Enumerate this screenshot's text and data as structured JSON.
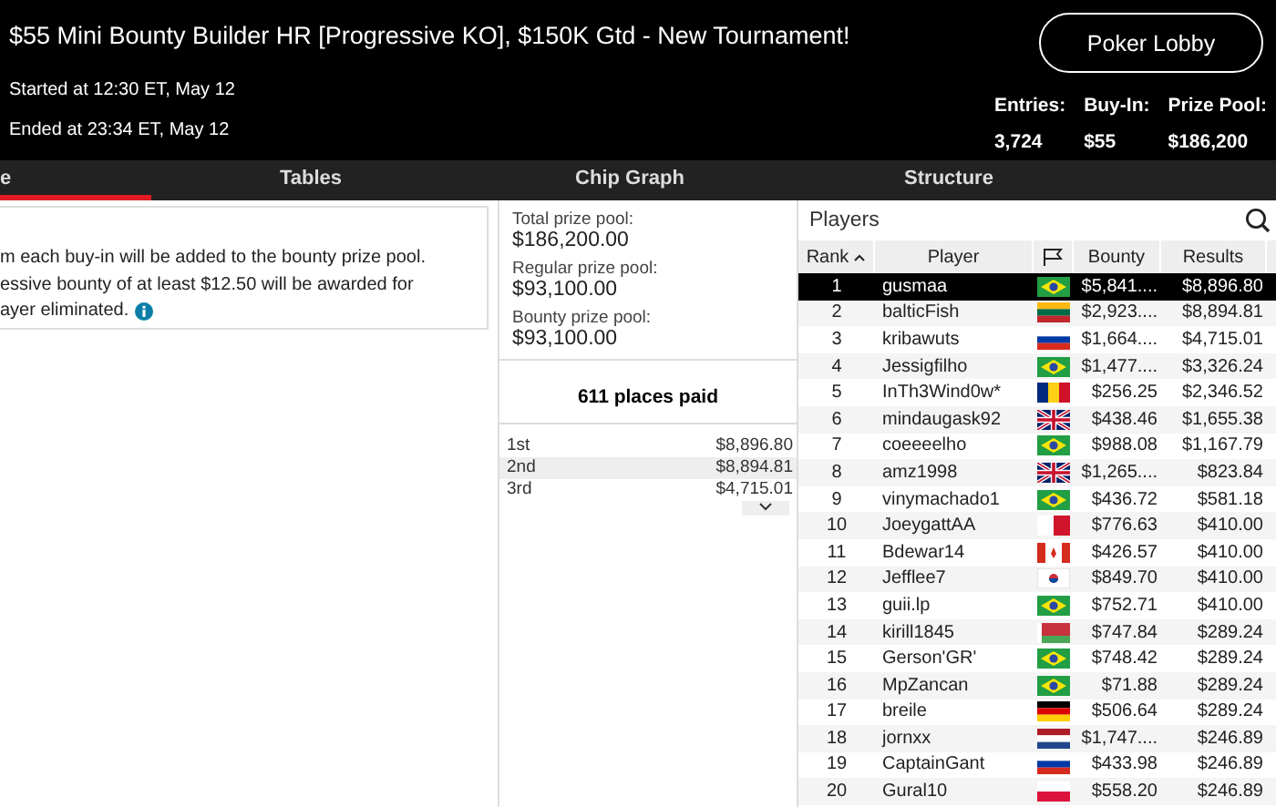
{
  "header": {
    "title": "$55 Mini Bounty Builder HR [Progressive KO], $150K Gtd - New Tournament!",
    "lobby_button": "Poker Lobby",
    "started": "Started at 12:30 ET, May 12",
    "ended": "Ended at 23:34 ET, May 12",
    "stats": [
      {
        "label": "Entries:",
        "value": "3,724"
      },
      {
        "label": "Buy-In:",
        "value": "$55"
      },
      {
        "label": "Prize Pool:",
        "value": "$186,200"
      }
    ]
  },
  "tabs": [
    {
      "label": "e",
      "selected": true
    },
    {
      "label": "Tables",
      "selected": false
    },
    {
      "label": "Chip Graph",
      "selected": false
    },
    {
      "label": "Structure",
      "selected": false
    }
  ],
  "info": {
    "lines": [
      "m each buy-in will be added to the bounty prize pool.",
      "essive bounty of at least $12.50 will be awarded for",
      "ayer eliminated."
    ]
  },
  "prize_pools": [
    {
      "label": "Total prize pool:",
      "value": "$186,200.00"
    },
    {
      "label": "Regular prize pool:",
      "value": "$93,100.00"
    },
    {
      "label": "Bounty prize pool:",
      "value": "$93,100.00"
    }
  ],
  "places_paid": "611 places paid",
  "payouts": [
    {
      "place": "1st",
      "amount": "$8,896.80"
    },
    {
      "place": "2nd",
      "amount": "$8,894.81"
    },
    {
      "place": "3rd",
      "amount": "$4,715.01"
    }
  ],
  "players": {
    "title": "Players",
    "columns": [
      "Rank",
      "Player",
      "Bounty",
      "Results"
    ],
    "rows": [
      {
        "rank": "1",
        "player": "gusmaa",
        "flag": {
          "kind": "br"
        },
        "bounty": "$5,841....",
        "result": "$8,896.80",
        "selected": true
      },
      {
        "rank": "2",
        "player": "balticFish",
        "flag": {
          "kind": "lt"
        },
        "bounty": "$2,923....",
        "result": "$8,894.81",
        "selected": false
      },
      {
        "rank": "3",
        "player": "kribawuts",
        "flag": {
          "kind": "ru"
        },
        "bounty": "$1,664....",
        "result": "$4,715.01",
        "selected": false
      },
      {
        "rank": "4",
        "player": "Jessigfilho",
        "flag": {
          "kind": "br"
        },
        "bounty": "$1,477....",
        "result": "$3,326.24",
        "selected": false
      },
      {
        "rank": "5",
        "player": "InTh3Wind0w*",
        "flag": {
          "kind": "ro"
        },
        "bounty": "$256.25",
        "result": "$2,346.52",
        "selected": false
      },
      {
        "rank": "6",
        "player": "mindaugask92",
        "flag": {
          "kind": "gb"
        },
        "bounty": "$438.46",
        "result": "$1,655.38",
        "selected": false
      },
      {
        "rank": "7",
        "player": "coeeeelho",
        "flag": {
          "kind": "br"
        },
        "bounty": "$988.08",
        "result": "$1,167.79",
        "selected": false
      },
      {
        "rank": "8",
        "player": "amz1998",
        "flag": {
          "kind": "gb"
        },
        "bounty": "$1,265....",
        "result": "$823.84",
        "selected": false
      },
      {
        "rank": "9",
        "player": "vinymachado1",
        "flag": {
          "kind": "br"
        },
        "bounty": "$436.72",
        "result": "$581.18",
        "selected": false
      },
      {
        "rank": "10",
        "player": "JoeygattAA",
        "flag": {
          "kind": "mt"
        },
        "bounty": "$776.63",
        "result": "$410.00",
        "selected": false
      },
      {
        "rank": "11",
        "player": "Bdewar14",
        "flag": {
          "kind": "ca"
        },
        "bounty": "$426.57",
        "result": "$410.00",
        "selected": false
      },
      {
        "rank": "12",
        "player": "Jefflee7",
        "flag": {
          "kind": "kr"
        },
        "bounty": "$849.70",
        "result": "$410.00",
        "selected": false
      },
      {
        "rank": "13",
        "player": "guii.lp",
        "flag": {
          "kind": "br"
        },
        "bounty": "$752.71",
        "result": "$410.00",
        "selected": false
      },
      {
        "rank": "14",
        "player": "kirill1845",
        "flag": {
          "kind": "by"
        },
        "bounty": "$747.84",
        "result": "$289.24",
        "selected": false
      },
      {
        "rank": "15",
        "player": "Gerson'GR'",
        "flag": {
          "kind": "br"
        },
        "bounty": "$748.42",
        "result": "$289.24",
        "selected": false
      },
      {
        "rank": "16",
        "player": "MpZancan",
        "flag": {
          "kind": "br"
        },
        "bounty": "$71.88",
        "result": "$289.24",
        "selected": false
      },
      {
        "rank": "17",
        "player": "breile",
        "flag": {
          "kind": "de"
        },
        "bounty": "$506.64",
        "result": "$289.24",
        "selected": false
      },
      {
        "rank": "18",
        "player": "jornxx",
        "flag": {
          "kind": "nl"
        },
        "bounty": "$1,747....",
        "result": "$246.89",
        "selected": false
      },
      {
        "rank": "19",
        "player": "CaptainGant",
        "flag": {
          "kind": "ru"
        },
        "bounty": "$433.98",
        "result": "$246.89",
        "selected": false
      },
      {
        "rank": "20",
        "player": "Gural10",
        "flag": {
          "kind": "pl"
        },
        "bounty": "$558.20",
        "result": "$246.89",
        "selected": false
      }
    ]
  }
}
